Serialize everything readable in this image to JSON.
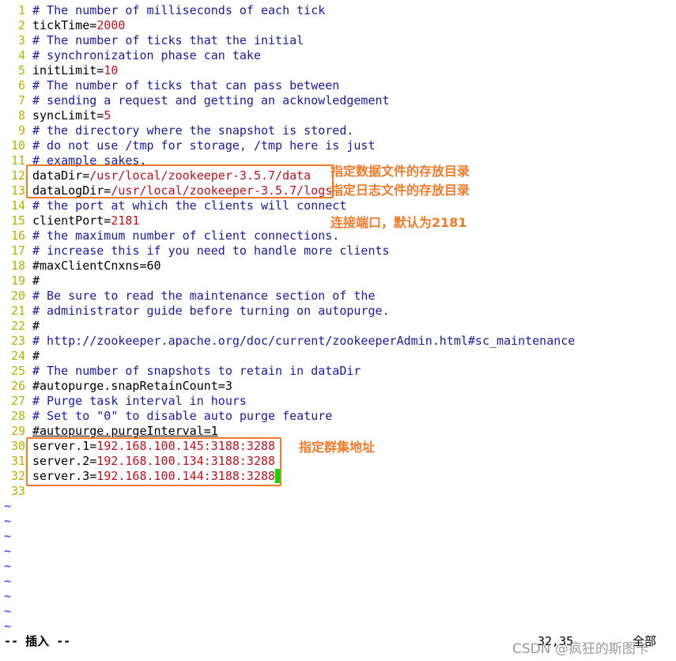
{
  "editor": {
    "lines": [
      {
        "n": "1",
        "type": "comment",
        "text": "# The number of milliseconds of each tick"
      },
      {
        "n": "2",
        "type": "kv",
        "key": "tickTime=",
        "value": "2000"
      },
      {
        "n": "3",
        "type": "comment",
        "text": "# The number of ticks that the initial"
      },
      {
        "n": "4",
        "type": "comment",
        "text": "# synchronization phase can take"
      },
      {
        "n": "5",
        "type": "kv",
        "key": "initLimit=",
        "value": "10"
      },
      {
        "n": "6",
        "type": "comment",
        "text": "# The number of ticks that can pass between"
      },
      {
        "n": "7",
        "type": "comment",
        "text": "# sending a request and getting an acknowledgement"
      },
      {
        "n": "8",
        "type": "kv",
        "key": "syncLimit=",
        "value": "5"
      },
      {
        "n": "9",
        "type": "comment",
        "text": "# the directory where the snapshot is stored."
      },
      {
        "n": "10",
        "type": "comment",
        "text": "# do not use /tmp for storage, /tmp here is just"
      },
      {
        "n": "11",
        "type": "comment",
        "text": "# example sakes."
      },
      {
        "n": "12",
        "type": "kv",
        "key": "dataDir=",
        "value": "/usr/local/zookeeper-3.5.7/data"
      },
      {
        "n": "13",
        "type": "kv",
        "key": "dataLogDir=",
        "value": "/usr/local/zookeeper-3.5.7/logs"
      },
      {
        "n": "14",
        "type": "comment",
        "text": "# the port at which the clients will connect"
      },
      {
        "n": "15",
        "type": "kv",
        "key": "clientPort=",
        "value": "2181"
      },
      {
        "n": "16",
        "type": "comment",
        "text": "# the maximum number of client connections."
      },
      {
        "n": "17",
        "type": "comment",
        "text": "# increase this if you need to handle more clients"
      },
      {
        "n": "18",
        "type": "plain",
        "text": "#maxClientCnxns=60"
      },
      {
        "n": "19",
        "type": "plain",
        "text": "#"
      },
      {
        "n": "20",
        "type": "comment",
        "text": "# Be sure to read the maintenance section of the"
      },
      {
        "n": "21",
        "type": "comment",
        "text": "# administrator guide before turning on autopurge."
      },
      {
        "n": "22",
        "type": "plain",
        "text": "#"
      },
      {
        "n": "23",
        "type": "comment",
        "text": "# http://zookeeper.apache.org/doc/current/zookeeperAdmin.html#sc_maintenance"
      },
      {
        "n": "24",
        "type": "plain",
        "text": "#"
      },
      {
        "n": "25",
        "type": "comment",
        "text": "# The number of snapshots to retain in dataDir"
      },
      {
        "n": "26",
        "type": "plain",
        "text": "#autopurge.snapRetainCount=3"
      },
      {
        "n": "27",
        "type": "comment",
        "text": "# Purge task interval in hours"
      },
      {
        "n": "28",
        "type": "comment",
        "text": "# Set to \"0\" to disable auto purge feature"
      },
      {
        "n": "29",
        "type": "plain_underline",
        "text": "#autopurge.purgeInterval=1"
      },
      {
        "n": "30",
        "type": "kv",
        "key": "server.1=",
        "value": "192.168.100.145:3188:3288"
      },
      {
        "n": "31",
        "type": "kv",
        "key": "server.2=",
        "value": "192.168.100.134:3188:3288"
      },
      {
        "n": "32",
        "type": "kv_cursor",
        "key": "server.3=",
        "value": "192.168.100.144:3188:3288"
      },
      {
        "n": "33",
        "type": "empty",
        "text": ""
      }
    ],
    "tilde_count": 9,
    "tilde_char": "~"
  },
  "annotations": {
    "data_dir_note": "指定数据文件的存放目录",
    "log_dir_note": "指定日志文件的存放目录",
    "client_port_note": "连接端口，默认为2181",
    "cluster_note": "指定群集地址",
    "color": "#f47a2a"
  },
  "statusbar": {
    "mode": "-- 插入 --",
    "position": "32,35",
    "scope": "全部"
  },
  "watermark": "CSDN @疯狂的斯图卡"
}
